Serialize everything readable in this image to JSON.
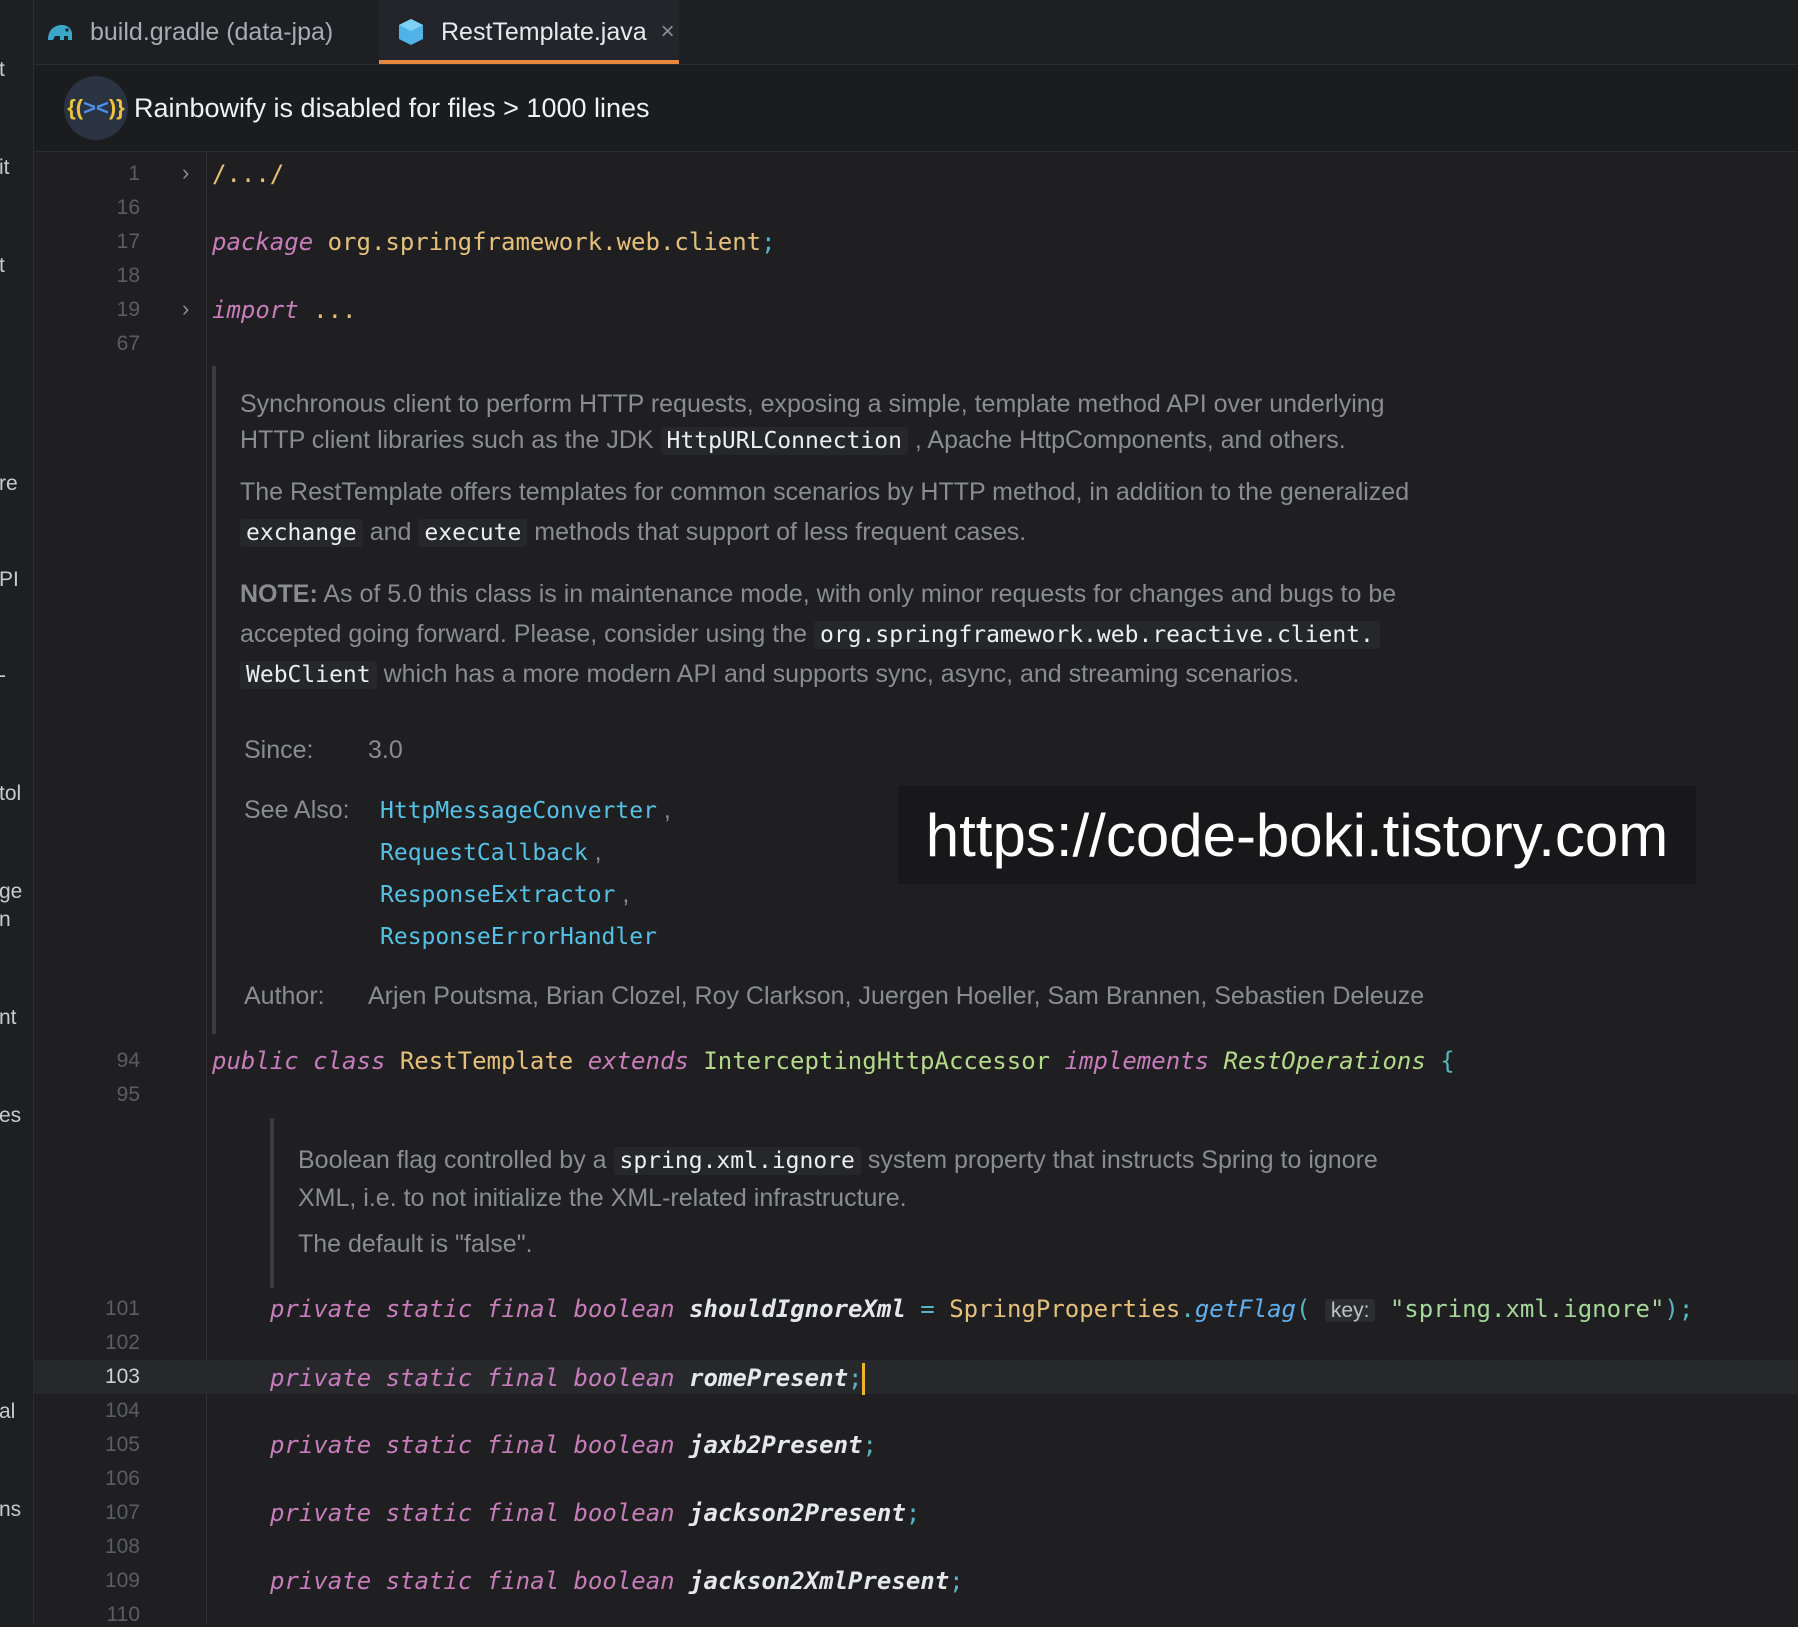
{
  "left_strip": [
    "t",
    "it",
    "t",
    "re",
    "PI",
    "-",
    "tol",
    "ge",
    "n",
    "nt",
    "es",
    "al",
    "ns"
  ],
  "tabs": {
    "gradle_label": "build.gradle (data-jpa)",
    "active_label": "RestTemplate.java",
    "close_symbol": "×"
  },
  "banner": {
    "logo_text": "{(><)}",
    "message": "Rainbowify is disabled for files > 1000 lines"
  },
  "lines": {
    "l1": "1",
    "l16": "16",
    "l17": "17",
    "l18": "18",
    "l19": "19",
    "l67": "67",
    "l94": "94",
    "l95": "95",
    "l101": "101",
    "l102": "102",
    "l103": "103",
    "l104": "104",
    "l105": "105",
    "l106": "106",
    "l107": "107",
    "l108": "108",
    "l109": "109",
    "l110": "110"
  },
  "code": {
    "folded_header": "/.../",
    "package_kw": "package",
    "package_name": "org.springframework.web.client",
    "semicolon": ";",
    "import_kw": "import",
    "import_ellipsis": "...",
    "public_kw": "public",
    "class_kw": "class",
    "class_name": "RestTemplate",
    "extends_kw": "extends",
    "superclass": "InterceptingHttpAccessor",
    "implements_kw": "implements",
    "interface": "RestOperations",
    "brace": "{",
    "private_kw": "private",
    "static_kw": "static",
    "final_kw": "final",
    "boolean_kw": "boolean",
    "field1": "shouldIgnoreXml",
    "equals": "=",
    "spring_props": "SpringProperties",
    "dot": ".",
    "get_flag": "getFlag",
    "open_paren": "(",
    "param_hint": "key:",
    "flag_string": "\"spring.xml.ignore\"",
    "close_paren_semi": ");",
    "field2": "romePresent",
    "field3": "jaxb2Present",
    "field4": "jackson2Present",
    "field5": "jackson2XmlPresent"
  },
  "doc1": {
    "p1a": "Synchronous client to perform HTTP requests, exposing a simple, template method API over underlying",
    "p1b_pre": "HTTP client libraries such as the JDK",
    "p1b_code": "HttpURLConnection",
    "p1b_post": ", Apache HttpComponents, and others.",
    "p2a": "The RestTemplate offers templates for common scenarios by HTTP method, in addition to the generalized",
    "p2b_code1": "exchange",
    "p2b_and": "and",
    "p2b_code2": "execute",
    "p2b_post": "methods that support of less frequent cases.",
    "note_label": "NOTE:",
    "p3a": "As of 5.0 this class is in maintenance mode, with only minor requests for changes and bugs to be",
    "p3b_pre": "accepted going forward. Please, consider using the",
    "p3b_code": "org.springframework.web.reactive.client.",
    "p3c_code": "WebClient",
    "p3c_post": "which has a more modern API and supports sync, async, and streaming scenarios.",
    "since_label": "Since:",
    "since_value": "3.0",
    "see_label": "See Also:",
    "see_links": [
      "HttpMessageConverter",
      "RequestCallback",
      "ResponseExtractor",
      "ResponseErrorHandler"
    ],
    "comma": ",",
    "author_label": "Author:",
    "author_value": "Arjen Poutsma, Brian Clozel, Roy Clarkson, Juergen Hoeller, Sam Brannen, Sebastien Deleuze"
  },
  "doc2": {
    "p1_pre": "Boolean flag controlled by a",
    "p1_code": "spring.xml.ignore",
    "p1_post": "system property that instructs Spring to ignore",
    "p2": "XML, i.e. to not initialize the XML-related infrastructure.",
    "p3": "The default is \"false\"."
  },
  "watermark": "https://code-boki.tistory.com",
  "colors": {
    "keyword": "#c77dbb",
    "type": "#e5c07b",
    "superclass": "#b5d98a",
    "link": "#56c1e6",
    "caret": "#f0b429",
    "tab_underline": "#e8873e"
  }
}
